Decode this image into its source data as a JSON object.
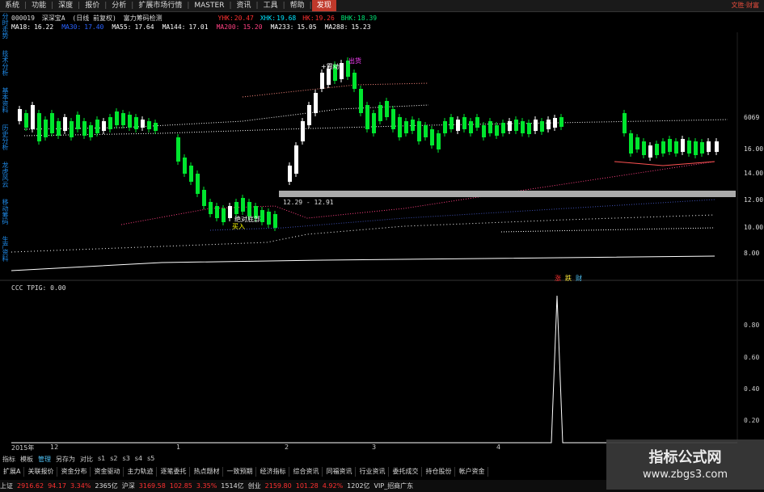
{
  "menu": [
    "系统",
    "功能",
    "深度",
    "报价",
    "分析",
    "扩展市场行情",
    "MASTER",
    "资讯",
    "工具",
    "帮助",
    "发现"
  ],
  "menu_active_index": 10,
  "brand": "文胜·财富",
  "vertical_tabs": [
    "分时走势",
    "技术分析",
    "基本资料",
    "历史分析",
    "龙虎风云",
    "移动筹码",
    "生产资料"
  ],
  "header": {
    "code": "000019",
    "name": "深深宝A",
    "period": "(日线 前复权)",
    "indicator": "富力筹码检测",
    "readouts": [
      {
        "label": "YHK:",
        "value": "20.47",
        "color": "#ff3030"
      },
      {
        "label": "XHK:",
        "value": "19.68",
        "color": "#00e5ff"
      },
      {
        "label": "HK:",
        "value": "19.26",
        "color": "#ff3030"
      },
      {
        "label": "BHK:",
        "value": "18.39",
        "color": "#00e676"
      }
    ]
  },
  "ma_line": [
    {
      "label": "MA18:",
      "value": "16.22",
      "color": "#ffffff"
    },
    {
      "label": "MA30:",
      "value": "17.40",
      "color": "#2962ff"
    },
    {
      "label": "MA55:",
      "value": "17.64",
      "color": "#ffffff"
    },
    {
      "label": "MA144:",
      "value": "17.01",
      "color": "#ffffff"
    },
    {
      "label": "MA200:",
      "value": "15.20",
      "color": "#ff4081"
    },
    {
      "label": "MA233:",
      "value": "15.05",
      "color": "#ffffff"
    },
    {
      "label": "MA288:",
      "value": "15.23",
      "color": "#ffffff"
    }
  ],
  "price_axis": [
    "6069",
    "16.00",
    "14.00",
    "12.00",
    "10.00",
    "8.00"
  ],
  "range_label": "12.29 - 12.91",
  "notes": [
    {
      "text": "出货",
      "color": "#ff40ff"
    },
    {
      "text": "+震动",
      "color": "#ffffff"
    },
    {
      "text": "绝对底部",
      "color": "#ffffff"
    },
    {
      "text": "买入",
      "color": "#ffff00"
    }
  ],
  "sub_chart": {
    "title": "CCC TPIG: 0.00",
    "axis": [
      "0.80",
      "0.60",
      "0.40",
      "0.20"
    ],
    "icons": [
      {
        "text": "涨",
        "color": "#ff3030"
      },
      {
        "text": "跌",
        "color": "#ffeb3b"
      },
      {
        "text": "财",
        "color": "#4fc3f7"
      }
    ]
  },
  "time_axis": [
    "2015年",
    "12",
    "1",
    "2",
    "3",
    "4"
  ],
  "bottom_toolbar": [
    "指标",
    "模板",
    "管理",
    "另存为",
    "对比",
    "s1",
    "s2",
    "s3",
    "s4",
    "s5"
  ],
  "bottom_tabs": [
    "扩展A",
    "关联报价",
    "资金分布",
    "资金驱动",
    "主力轨迹",
    "逐笔委托",
    "热点题材",
    "一致预期",
    "经济指标",
    "综合资讯",
    "同福资讯",
    "行业资讯",
    "委托成交",
    "持仓股份",
    "帐户资金"
  ],
  "status": [
    {
      "text": "上证",
      "color": "#ddd"
    },
    {
      "text": "2916.62",
      "color": "#ff3030"
    },
    {
      "text": "94.17",
      "color": "#ff3030"
    },
    {
      "text": "3.34%",
      "color": "#ff3030"
    },
    {
      "text": "2365亿",
      "color": "#ddd"
    },
    {
      "text": "沪深",
      "color": "#ddd"
    },
    {
      "text": "3169.58",
      "color": "#ff3030"
    },
    {
      "text": "102.85",
      "color": "#ff3030"
    },
    {
      "text": "3.35%",
      "color": "#ff3030"
    },
    {
      "text": "1514亿",
      "color": "#ddd"
    },
    {
      "text": "创业",
      "color": "#ddd"
    },
    {
      "text": "2159.80",
      "color": "#ff3030"
    },
    {
      "text": "101.28",
      "color": "#ff3030"
    },
    {
      "text": "4.92%",
      "color": "#ff3030"
    },
    {
      "text": "1202亿",
      "color": "#ddd"
    },
    {
      "text": "VIP_招商广东",
      "color": "#ddd"
    }
  ],
  "watermark": {
    "line1": "指标公式网",
    "line2": "www.zbgs3.com"
  }
}
